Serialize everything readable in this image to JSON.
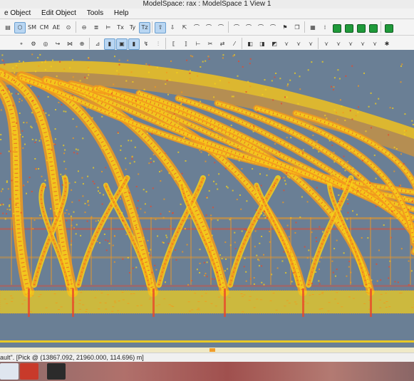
{
  "window": {
    "title": "ModelSpace: rax : ModelSpace 1 View 1"
  },
  "menu": {
    "items": [
      "e Object",
      "Edit Object",
      "Tools",
      "Help"
    ]
  },
  "toolbar1": {
    "buttons": [
      {
        "name": "align-icon",
        "glyph": "▤"
      },
      {
        "name": "cube-icon",
        "glyph": "⬡"
      },
      {
        "name": "sm-button",
        "glyph": "SM"
      },
      {
        "name": "cm-button",
        "glyph": "CM"
      },
      {
        "name": "ae-button",
        "glyph": "AE"
      },
      {
        "name": "cylinder-icon",
        "glyph": "⊙"
      },
      {
        "name": "cylinder-cut-icon",
        "glyph": "⊖"
      },
      {
        "name": "layers-icon",
        "glyph": "≣"
      },
      {
        "name": "align-x-icon",
        "glyph": "⊨"
      },
      {
        "name": "tx-button",
        "glyph": "Tx"
      },
      {
        "name": "ty-button",
        "glyph": "Ty"
      },
      {
        "name": "tz-button",
        "glyph": "Tz"
      },
      {
        "name": "move-up-icon",
        "glyph": "⇧"
      },
      {
        "name": "move-down-icon",
        "glyph": "⇩"
      },
      {
        "name": "select-icon",
        "glyph": "⇱"
      },
      {
        "name": "pipe-icon-1",
        "glyph": "⌒"
      },
      {
        "name": "pipe-icon-2",
        "glyph": "⌒"
      },
      {
        "name": "pipe-icon-3",
        "glyph": "⌒"
      },
      {
        "name": "pipe-icon-4",
        "glyph": "⌒"
      },
      {
        "name": "pipe-icon-5",
        "glyph": "⌒"
      },
      {
        "name": "pipe-icon-6",
        "glyph": "⌒"
      },
      {
        "name": "pipe-icon-7",
        "glyph": "⌒"
      },
      {
        "name": "tag-icon",
        "glyph": "⚑"
      },
      {
        "name": "copy-icon",
        "glyph": "❐"
      },
      {
        "name": "grid-icon",
        "glyph": "▦"
      },
      {
        "name": "dots-icon",
        "glyph": "⁞"
      },
      {
        "name": "layer-green-1",
        "glyph": ""
      },
      {
        "name": "layer-green-2",
        "glyph": ""
      },
      {
        "name": "layer-green-3",
        "glyph": ""
      },
      {
        "name": "layer-green-4",
        "glyph": ""
      },
      {
        "name": "layer-green-5",
        "glyph": ""
      }
    ]
  },
  "toolbar2": {
    "buttons": [
      {
        "name": "node-icon",
        "glyph": "⚬"
      },
      {
        "name": "gear-icon",
        "glyph": "⚙"
      },
      {
        "name": "torus-icon",
        "glyph": "◎"
      },
      {
        "name": "pipe-bend-icon",
        "glyph": "↪"
      },
      {
        "name": "valve-icon",
        "glyph": "⋈"
      },
      {
        "name": "flange-icon",
        "glyph": "⊕"
      },
      {
        "name": "measure-icon",
        "glyph": "⊿"
      },
      {
        "name": "tank-icon",
        "glyph": "▮"
      },
      {
        "name": "box-icon",
        "glyph": "▣"
      },
      {
        "name": "cylinder-active-icon",
        "glyph": "▮"
      },
      {
        "name": "route-icon",
        "glyph": "↯"
      },
      {
        "name": "split-icon",
        "glyph": "⫶"
      },
      {
        "name": "bracket-icon-1",
        "glyph": "⟦"
      },
      {
        "name": "bracket-icon-2",
        "glyph": "⟧"
      },
      {
        "name": "join-icon",
        "glyph": "⊢"
      },
      {
        "name": "cut-icon",
        "glyph": "✂"
      },
      {
        "name": "arrows-icon",
        "glyph": "⇄"
      },
      {
        "name": "line-icon",
        "glyph": "⁄"
      },
      {
        "name": "color-icon-1",
        "glyph": "◧"
      },
      {
        "name": "color-icon-2",
        "glyph": "◨"
      },
      {
        "name": "color-icon-3",
        "glyph": "◩"
      },
      {
        "name": "weld-icon-1",
        "glyph": "⋎"
      },
      {
        "name": "weld-icon-2",
        "glyph": "⋎"
      },
      {
        "name": "weld-icon-3",
        "glyph": "⋎"
      },
      {
        "name": "weld-icon-4",
        "glyph": "⋎"
      },
      {
        "name": "weld-icon-5",
        "glyph": "⋎"
      },
      {
        "name": "weld-icon-6",
        "glyph": "⋎"
      },
      {
        "name": "weld-icon-7",
        "glyph": "⋎"
      },
      {
        "name": "weld-icon-8",
        "glyph": "⋎"
      },
      {
        "name": "bulb-icon",
        "glyph": "✱"
      }
    ]
  },
  "status": {
    "text": "ault\". [Pick @ (13867.092, 21960.000, 114.696) m]"
  },
  "colors": {
    "background": "#6a7f95",
    "points_yellow": "#f6d21a",
    "points_orange": "#f39a1c",
    "points_red": "#e8472a",
    "scroll_thumb": "#f29d2a"
  },
  "taskbar": {
    "items": [
      {
        "name": "taskbar-app-1"
      },
      {
        "name": "taskbar-app-2"
      },
      {
        "name": "taskbar-app-3"
      }
    ]
  }
}
